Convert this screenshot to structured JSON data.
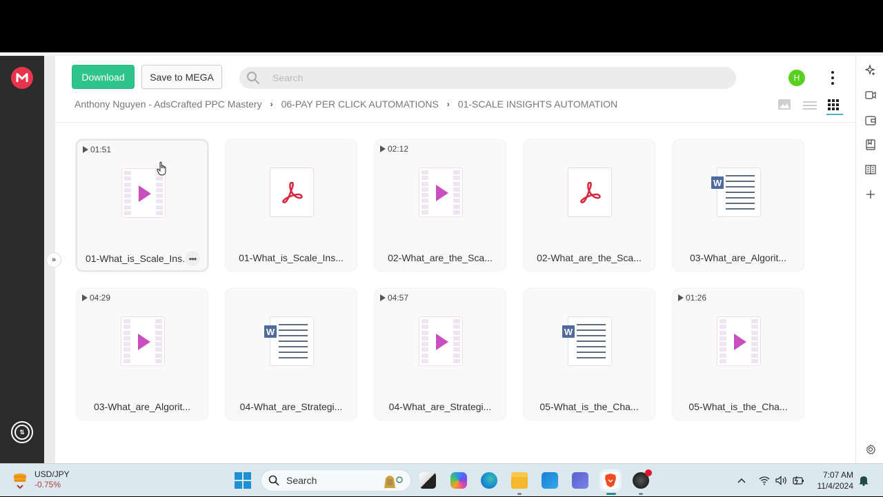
{
  "app": {
    "name": "MEGA",
    "logo_letter": "M",
    "brand_color": "#e8344c"
  },
  "toolbar": {
    "download_label": "Download",
    "save_label": "Save to MEGA",
    "search_placeholder": "Search",
    "search_value": "",
    "avatar_initial": "H",
    "avatar_color": "#58d01e"
  },
  "breadcrumb": [
    {
      "label": "Anthony Nguyen - AdsCrafted PPC Mastery"
    },
    {
      "label": "06-PAY PER CLICK AUTOMATIONS"
    },
    {
      "label": "01-SCALE INSIGHTS AUTOMATION"
    }
  ],
  "view_modes": [
    {
      "name": "thumbnail",
      "active": false
    },
    {
      "name": "list",
      "active": false
    },
    {
      "name": "grid",
      "active": true
    }
  ],
  "files": [
    {
      "type": "video",
      "duration": "01:51",
      "name": "01-What_is_Scale_Ins.",
      "selected": true,
      "more_label": "•••"
    },
    {
      "type": "pdf",
      "duration": "",
      "name": "01-What_is_Scale_Ins...",
      "selected": false
    },
    {
      "type": "video",
      "duration": "02:12",
      "name": "02-What_are_the_Sca...",
      "selected": false
    },
    {
      "type": "pdf",
      "duration": "",
      "name": "02-What_are_the_Sca...",
      "selected": false
    },
    {
      "type": "doc",
      "duration": "",
      "name": "03-What_are_Algorit...",
      "selected": false
    },
    {
      "type": "video",
      "duration": "04:29",
      "name": "03-What_are_Algorit...",
      "selected": false
    },
    {
      "type": "doc",
      "duration": "",
      "name": "04-What_are_Strategi...",
      "selected": false
    },
    {
      "type": "video",
      "duration": "04:57",
      "name": "04-What_are_Strategi...",
      "selected": false
    },
    {
      "type": "doc",
      "duration": "",
      "name": "05-What_is_the_Cha...",
      "selected": false
    },
    {
      "type": "video",
      "duration": "01:26",
      "name": "05-What_is_the_Cha...",
      "selected": false
    }
  ],
  "word_badge": "W",
  "sidebar_right_icons": [
    "sparkle-add-icon",
    "video-camera-icon",
    "wallet-icon",
    "bookmark-book-icon",
    "reader-icon",
    "plus-icon",
    "gear-icon"
  ],
  "taskbar": {
    "ticker_symbol": "USD/JPY",
    "ticker_change": "-0.75%",
    "search_label": "Search",
    "apps": [
      "task-view",
      "copilot",
      "edge",
      "file-explorer",
      "outlook",
      "teams",
      "brave",
      "obs"
    ],
    "time": "7:07 AM",
    "date": "11/4/2024"
  }
}
